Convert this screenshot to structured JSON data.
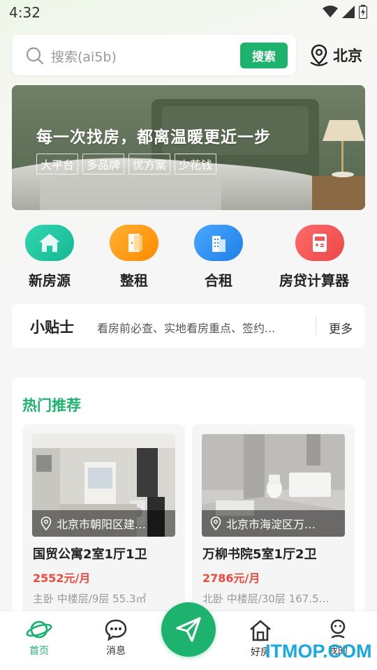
{
  "status_bar": {
    "time": "4:32"
  },
  "search": {
    "placeholder": "搜索(ai5b)",
    "button_label": "搜索"
  },
  "location": {
    "city": "北京"
  },
  "banner": {
    "title": "每一次找房，都离温暖更近一步",
    "tags": [
      "大平台",
      "多品牌",
      "优方案",
      "少花钱"
    ]
  },
  "quick_menu": {
    "items": [
      {
        "label": "新房源",
        "icon": "house-icon",
        "color": "#1ec9a3"
      },
      {
        "label": "整租",
        "icon": "door-icon",
        "color": "#ff9f1a"
      },
      {
        "label": "合租",
        "icon": "building-icon",
        "color": "#2b8ff2"
      },
      {
        "label": "房贷计算器",
        "icon": "calculator-icon",
        "color": "#f25656"
      }
    ]
  },
  "tips": {
    "title": "小贴士",
    "text": "看房前必查、实地看房重点、签约...",
    "more_label": "更多"
  },
  "recommendations": {
    "title": "热门推荐",
    "cards": [
      {
        "location": "北京市朝阳区建…",
        "title": "国贸公寓2室1厅1卫",
        "price": "2552元/月",
        "detail": "主卧 中楼层/9层 55.3㎡"
      },
      {
        "location": "北京市海淀区万…",
        "title": "万柳书院5室1厅2卫",
        "price": "2786元/月",
        "detail": "北卧 中楼层/30层 167.5…"
      }
    ]
  },
  "bottom_nav": {
    "items": [
      {
        "label": "首页",
        "icon": "planet-icon",
        "active": true
      },
      {
        "label": "消息",
        "icon": "chat-bubble-icon",
        "active": false
      },
      {
        "label": "",
        "icon": "send-icon",
        "active": false
      },
      {
        "label": "好房",
        "icon": "house-outline-icon",
        "active": false
      },
      {
        "label": "我的",
        "icon": "profile-icon",
        "active": false
      }
    ]
  },
  "watermark": "ITMOP.COM",
  "colors": {
    "accent": "#1db36e",
    "price": "#f0483e",
    "watermark": "#1aa8e0"
  }
}
